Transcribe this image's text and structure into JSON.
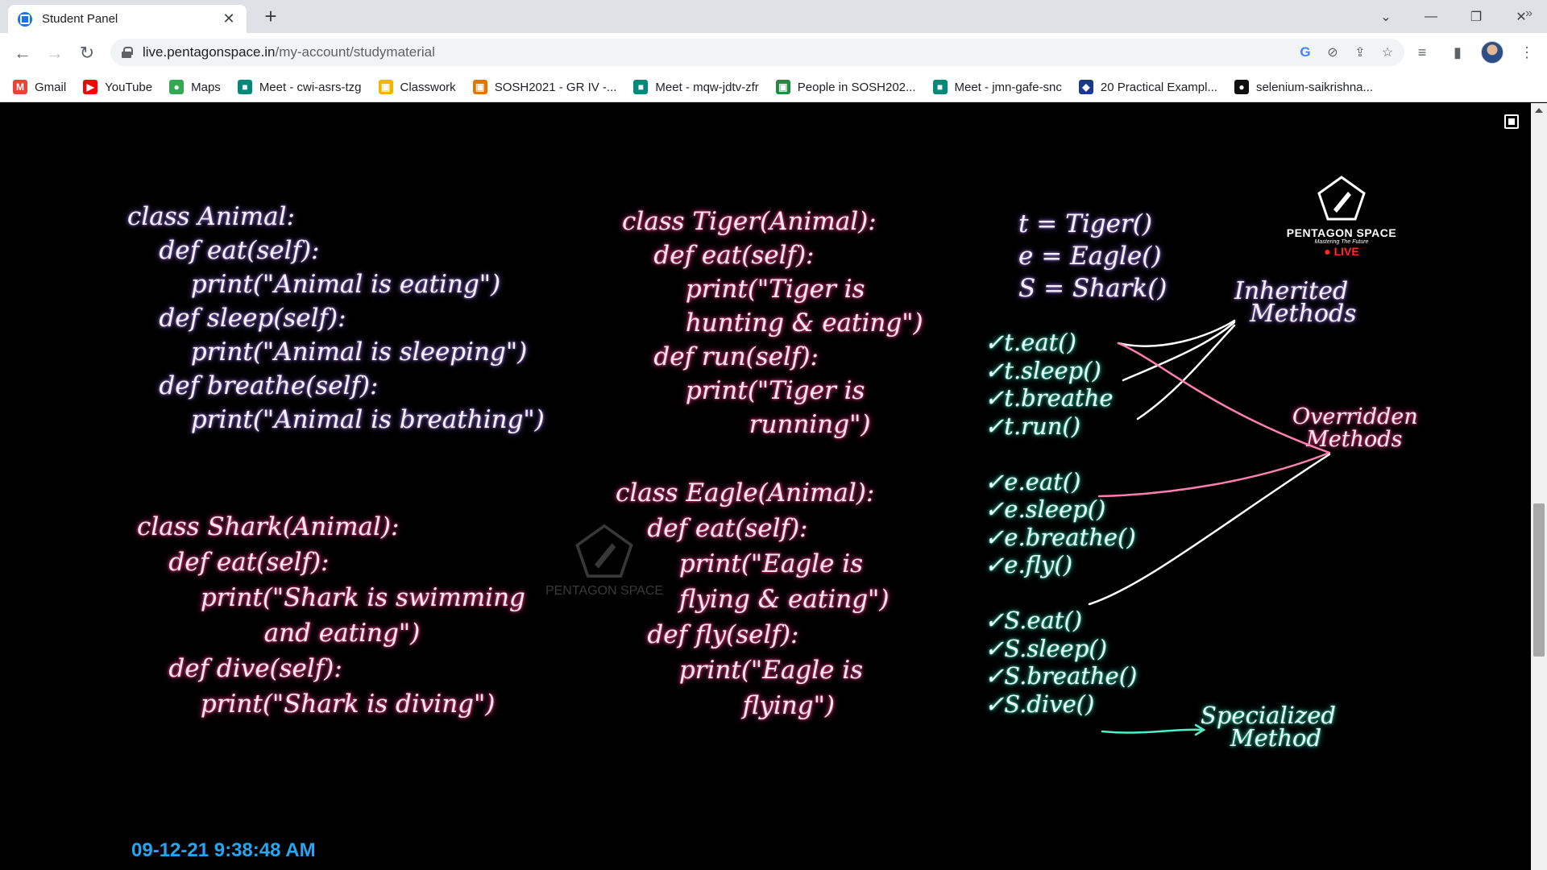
{
  "tab": {
    "title": "Student Panel"
  },
  "address": {
    "domain": "live.pentagonspace.in",
    "path": "/my-account/studymaterial"
  },
  "bookmarks": [
    {
      "label": "Gmail",
      "icon": "gmail-icon",
      "color": "#ea4335",
      "glyph": "M"
    },
    {
      "label": "YouTube",
      "icon": "youtube-icon",
      "color": "#ff0000",
      "glyph": "▶"
    },
    {
      "label": "Maps",
      "icon": "maps-icon",
      "color": "#34a853",
      "glyph": "●"
    },
    {
      "label": "Meet - cwi-asrs-tzg",
      "icon": "meet-icon",
      "color": "#00897b",
      "glyph": "■"
    },
    {
      "label": "Classwork",
      "icon": "classwork-icon",
      "color": "#f4b400",
      "glyph": "▣"
    },
    {
      "label": "SOSH2021 - GR IV -...",
      "icon": "classroom-icon",
      "color": "#e37400",
      "glyph": "▣"
    },
    {
      "label": "Meet - mqw-jdtv-zfr",
      "icon": "meet-icon",
      "color": "#00897b",
      "glyph": "■"
    },
    {
      "label": "People in SOSH202...",
      "icon": "people-icon",
      "color": "#1e8e3e",
      "glyph": "▣"
    },
    {
      "label": "Meet - jmn-gafe-snc",
      "icon": "meet-icon",
      "color": "#00897b",
      "glyph": "■"
    },
    {
      "label": "20 Practical Exampl...",
      "icon": "shield-icon",
      "color": "#1a3a8f",
      "glyph": "◆"
    },
    {
      "label": "selenium-saikrishna...",
      "icon": "github-icon",
      "color": "#111111",
      "glyph": "●"
    }
  ],
  "board": {
    "animal": [
      "class Animal:",
      "    def eat(self):",
      "        print(\"Animal is eating\")",
      "    def sleep(self):",
      "        print(\"Animal is sleeping\")",
      "    def breathe(self):",
      "        print(\"Animal is breathing\")"
    ],
    "shark": [
      "class Shark(Animal):",
      "    def eat(self):",
      "        print(\"Shark is swimming",
      "                and eating\")",
      "    def dive(self):",
      "        print(\"Shark is diving\")"
    ],
    "tiger": [
      "class Tiger(Animal):",
      "    def eat(self):",
      "        print(\"Tiger is",
      "        hunting & eating\")",
      "    def run(self):",
      "        print(\"Tiger is",
      "                running\")"
    ],
    "eagle": [
      "class Eagle(Animal):",
      "    def eat(self):",
      "        print(\"Eagle is",
      "        flying & eating\")",
      "    def fly(self):",
      "        print(\"Eagle is",
      "                flying\")"
    ],
    "objects": [
      "t = Tiger()",
      "e = Eagle()",
      "S = Shark()"
    ],
    "calls": [
      "✓t.eat()",
      "✓t.sleep()",
      "✓t.breathe",
      "✓t.run()",
      "",
      "✓e.eat()",
      "✓e.sleep()",
      "✓e.breathe()",
      "✓e.fly()",
      "",
      "✓S.eat()",
      "✓S.sleep()",
      "✓S.breathe()",
      "✓S.dive()"
    ],
    "inherited": "Inherited\n  Methods",
    "overridden": "Overridden\n  Methods",
    "specialized": "Specialized\n    Method",
    "timestamp": "09-12-21 9:38:48 AM"
  },
  "logo": {
    "name": "PENTAGON SPACE",
    "tagline": "Mastering The Future",
    "live": "● LIVE"
  },
  "colors": {
    "accent": "#27a5f0",
    "live": "#ff2a2a"
  }
}
